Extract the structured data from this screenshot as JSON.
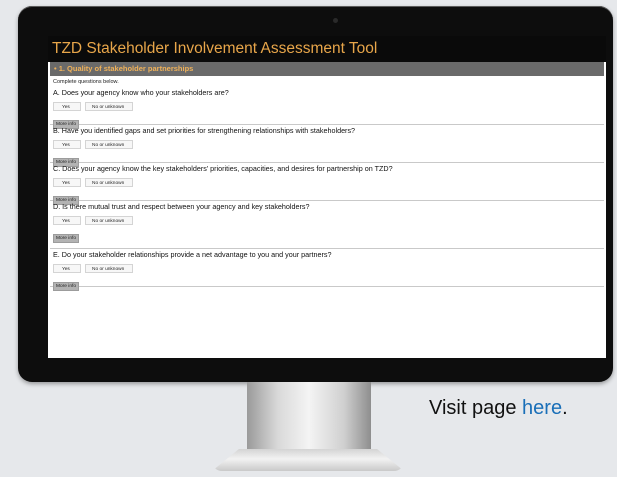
{
  "app": {
    "title": "TZD Stakeholder Involvement Assessment Tool",
    "section": "• 1. Quality of stakeholder partnerships",
    "instructions": "Complete questions below."
  },
  "questions": [
    {
      "text": "A. Does your agency know who your stakeholders are?",
      "yes": "Yes",
      "no": "No or unknown",
      "more": "More info"
    },
    {
      "text": "B. Have you identified gaps and set priorities for strengthening relationships with stakeholders?",
      "yes": "Yes",
      "no": "No or unknown",
      "more": "More info"
    },
    {
      "text": "C. Does your agency know the key stakeholders’ priorities, capacities, and desires for partnership on TZD?",
      "yes": "Yes",
      "no": "No or unknown",
      "more": "More info"
    },
    {
      "text": "D. Is there mutual trust and respect between your agency and key stakeholders?",
      "yes": "Yes",
      "no": "No or unknown",
      "more": "More info"
    },
    {
      "text": "E. Do your stakeholder relationships provide a net advantage to you and your partners?",
      "yes": "Yes",
      "no": "No or unknown",
      "more": "More info"
    }
  ],
  "caption": {
    "prefix": "Visit page ",
    "link": "here",
    "suffix": "."
  },
  "colors": {
    "header_bg": "#0a0a0a",
    "title_text": "#e8a64a",
    "section_bg": "#6a6a6a",
    "link": "#1a6fb8"
  }
}
